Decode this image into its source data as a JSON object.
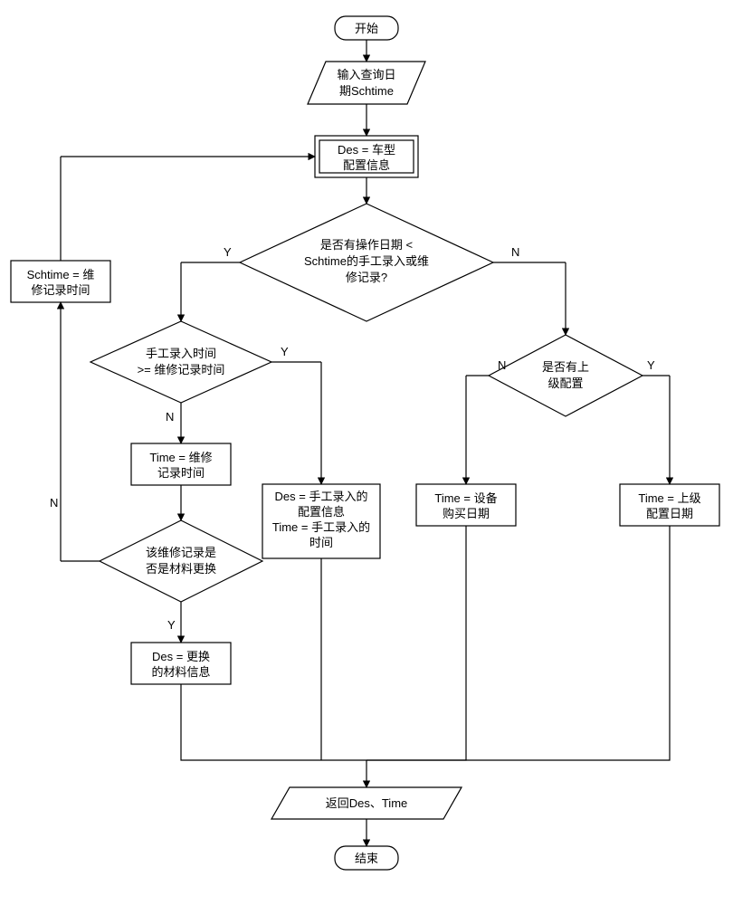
{
  "chart_data": {
    "type": "flowchart",
    "nodes": [
      {
        "id": "start",
        "shape": "terminator",
        "label": "开始"
      },
      {
        "id": "input",
        "shape": "parallelogram",
        "label": "输入查询日期Schtime"
      },
      {
        "id": "des_init",
        "shape": "process_double",
        "label": "Des = 车型配置信息"
      },
      {
        "id": "d1",
        "shape": "decision",
        "label": "是否有操作日期 < Schtime的手工录入或维修记录?"
      },
      {
        "id": "d2",
        "shape": "decision",
        "label": "手工录入时间 >= 维修记录时间"
      },
      {
        "id": "d3",
        "shape": "decision",
        "label": "是否有上级配置"
      },
      {
        "id": "sch_set",
        "shape": "process",
        "label": "Schtime = 维修记录时间"
      },
      {
        "id": "time_repair",
        "shape": "process",
        "label": "Time = 维修记录时间"
      },
      {
        "id": "d4",
        "shape": "decision",
        "label": "该维修记录是否是材料更换"
      },
      {
        "id": "des_replace",
        "shape": "process",
        "label": "Des = 更换的材料信息"
      },
      {
        "id": "manual",
        "shape": "process",
        "label": "Des = 手工录入的配置信息 Time = 手工录入的时间"
      },
      {
        "id": "time_buy",
        "shape": "process",
        "label": "Time = 设备购买日期"
      },
      {
        "id": "time_parent",
        "shape": "process",
        "label": "Time = 上级配置日期"
      },
      {
        "id": "return",
        "shape": "parallelogram",
        "label": "返回Des、Time"
      },
      {
        "id": "end",
        "shape": "terminator",
        "label": "结束"
      }
    ],
    "edges": [
      {
        "from": "start",
        "to": "input"
      },
      {
        "from": "input",
        "to": "des_init"
      },
      {
        "from": "des_init",
        "to": "d1"
      },
      {
        "from": "d1",
        "to": "d2",
        "label": "Y"
      },
      {
        "from": "d1",
        "to": "d3",
        "label": "N"
      },
      {
        "from": "d2",
        "to": "time_repair",
        "label": "N",
        "via": "down"
      },
      {
        "from": "d2",
        "to": "manual",
        "label": "Y"
      },
      {
        "from": "time_repair",
        "to": "d4"
      },
      {
        "from": "d4",
        "to": "des_replace",
        "label": "Y"
      },
      {
        "from": "d4",
        "to": "sch_set",
        "label": "N"
      },
      {
        "from": "sch_set",
        "to": "des_init"
      },
      {
        "from": "d3",
        "to": "time_buy",
        "label": "N"
      },
      {
        "from": "d3",
        "to": "time_parent",
        "label": "Y"
      },
      {
        "from": "des_replace",
        "to": "return"
      },
      {
        "from": "manual",
        "to": "return"
      },
      {
        "from": "time_buy",
        "to": "return"
      },
      {
        "from": "time_parent",
        "to": "return"
      },
      {
        "from": "return",
        "to": "end"
      }
    ]
  },
  "labels": {
    "start": "开始",
    "input_l1": "输入查询日",
    "input_l2": "期Schtime",
    "des_init_l1": "Des = 车型",
    "des_init_l2": "配置信息",
    "d1_l1": "是否有操作日期 <",
    "d1_l2": "Schtime的手工录入或维",
    "d1_l3": "修记录?",
    "d2_l1": "手工录入时间",
    "d2_l2": ">= 维修记录时间",
    "d3_l1": "是否有上",
    "d3_l2": "级配置",
    "sch_set_l1": "Schtime = 维",
    "sch_set_l2": "修记录时间",
    "time_repair_l1": "Time = 维修",
    "time_repair_l2": "记录时间",
    "d4_l1": "该维修记录是",
    "d4_l2": "否是材料更换",
    "des_replace_l1": "Des = 更换",
    "des_replace_l2": "的材料信息",
    "manual_l1": "Des = 手工录入的",
    "manual_l2": "配置信息",
    "manual_l3": "Time = 手工录入的",
    "manual_l4": "时间",
    "time_buy_l1": "Time = 设备",
    "time_buy_l2": "购买日期",
    "time_parent_l1": "Time = 上级",
    "time_parent_l2": "配置日期",
    "return": "返回Des、Time",
    "end": "结束",
    "Y": "Y",
    "N": "N"
  }
}
